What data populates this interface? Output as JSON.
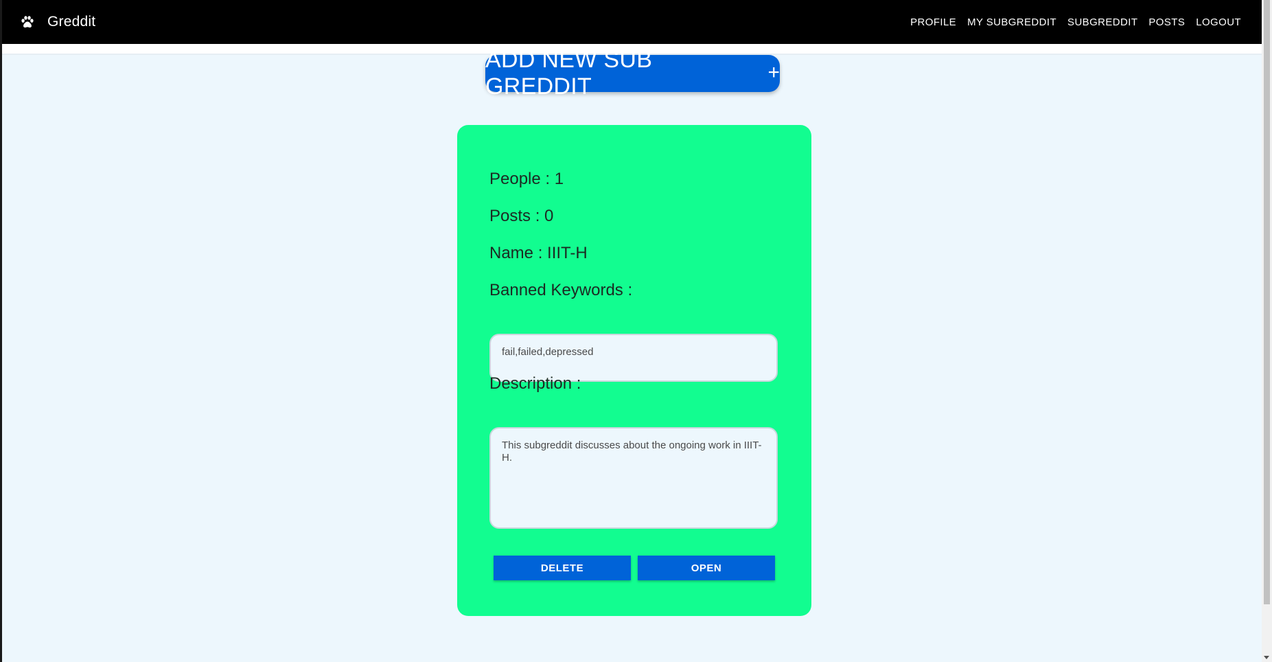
{
  "app": {
    "title": "Greddit",
    "logo_icon": "paw-icon"
  },
  "nav": {
    "items": [
      {
        "label": "PROFILE"
      },
      {
        "label": "MY SUBGREDDIT"
      },
      {
        "label": "SUBGREDDIT"
      },
      {
        "label": "POSTS"
      },
      {
        "label": "LOGOUT"
      }
    ]
  },
  "add_button": {
    "label": "ADD NEW SUB GREDDIT",
    "icon": "plus-icon",
    "icon_glyph": "+"
  },
  "card": {
    "people": "People : 1",
    "posts": "Posts : 0",
    "name": "Name : IIIT-H",
    "banned_label": "Banned Keywords :",
    "banned_value": "fail,failed,depressed",
    "description_label": "Description :",
    "description_value": "This subgreddit discusses about the ongoing work in IIIT-H.",
    "delete_label": "DELETE",
    "open_label": "OPEN"
  },
  "colors": {
    "appbar": "#000000",
    "background": "#edf7fd",
    "card": "#12fd90",
    "primary": "#0063d8"
  }
}
